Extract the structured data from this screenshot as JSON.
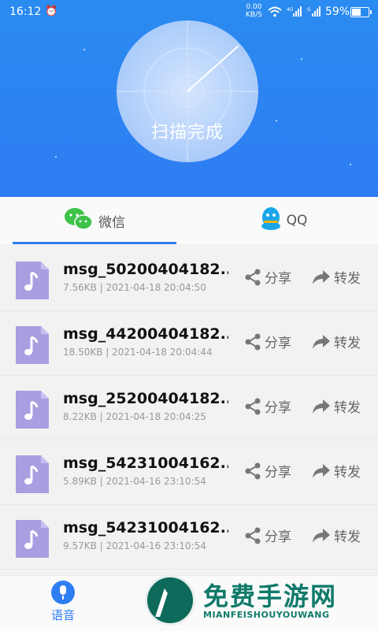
{
  "status_bar": {
    "time": "16:12",
    "alarm_icon": "alarm-icon",
    "net_speed": "0.00",
    "net_speed_unit": "KB/S",
    "battery_pct": "59%",
    "battery_level": 0.59
  },
  "scan": {
    "status_text": "扫描完成"
  },
  "tabs": [
    {
      "label": "微信",
      "icon": "wechat-icon",
      "active": true
    },
    {
      "label": "QQ",
      "icon": "qq-icon",
      "active": false
    }
  ],
  "files": [
    {
      "name": "msg_50200404182...",
      "meta": "7.56KB | 2021-04-18 20:04:50"
    },
    {
      "name": "msg_44200404182...",
      "meta": "18.50KB | 2021-04-18 20:04:44"
    },
    {
      "name": "msg_25200404182...",
      "meta": "8.22KB | 2021-04-18 20:04:25"
    },
    {
      "name": "msg_54231004162...",
      "meta": "5.89KB | 2021-04-16 23:10:54"
    },
    {
      "name": "msg_54231004162...",
      "meta": "9.57KB | 2021-04-16 23:10:54"
    }
  ],
  "actions": {
    "share_label": "分享",
    "forward_label": "转发"
  },
  "bottom_nav": {
    "voice_label": "语音"
  },
  "watermark": {
    "main": "免费手游网",
    "sub": "MIANFEISHOUYOUWANG"
  },
  "colors": {
    "accent": "#2f7df2",
    "file_icon": "#a99ee0",
    "watermark": "#0f7a6a"
  }
}
